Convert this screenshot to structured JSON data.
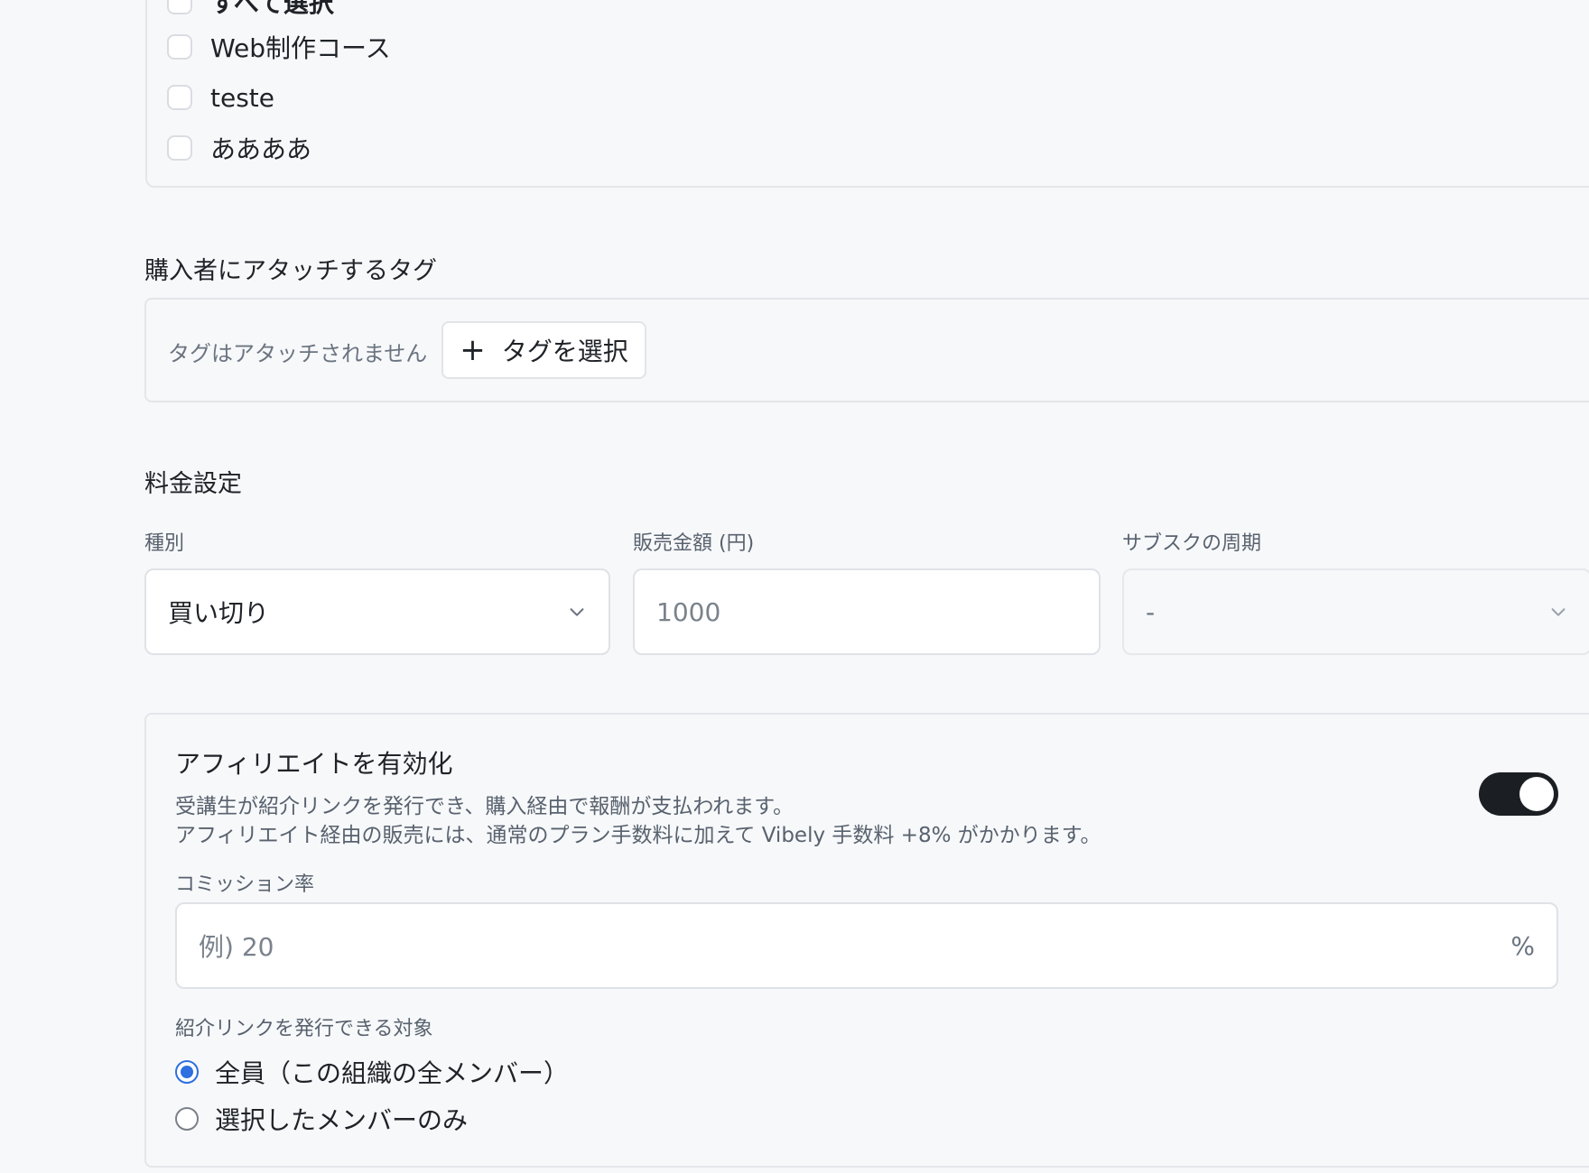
{
  "courses": {
    "select_all_label": "すべて選択",
    "items": [
      {
        "label": "Web制作コース",
        "checked": false
      },
      {
        "label": "teste",
        "checked": false
      },
      {
        "label": "ああああ",
        "checked": false
      }
    ]
  },
  "tags": {
    "section_title": "購入者にアタッチするタグ",
    "empty_text": "タグはアタッチされません",
    "select_button_label": "タグを選択"
  },
  "pricing": {
    "section_title": "料金設定",
    "type_label": "種別",
    "type_value": "買い切り",
    "price_label": "販売金額 (円)",
    "price_placeholder": "1000",
    "cycle_label": "サブスクの周期",
    "cycle_value": "-"
  },
  "affiliate": {
    "title": "アフィリエイトを有効化",
    "desc_line1": "受講生が紹介リンクを発行でき、購入経由で報酬が支払われます。",
    "desc_line2": "アフィリエイト経由の販売には、通常のプラン手数料に加えて Vibely 手数料 +8% がかかります。",
    "enabled": true,
    "commission_label": "コミッション率",
    "commission_placeholder": "例) 20",
    "commission_suffix": "%",
    "target_label": "紹介リンクを発行できる対象",
    "target_options": [
      {
        "label": "全員（この組織の全メンバー）",
        "checked": true
      },
      {
        "label": "選択したメンバーのみ",
        "checked": false
      }
    ]
  },
  "colors": {
    "accent": "#2f6fe0",
    "toggle_on": "#1b1f23",
    "background": "#f7f8fa"
  }
}
